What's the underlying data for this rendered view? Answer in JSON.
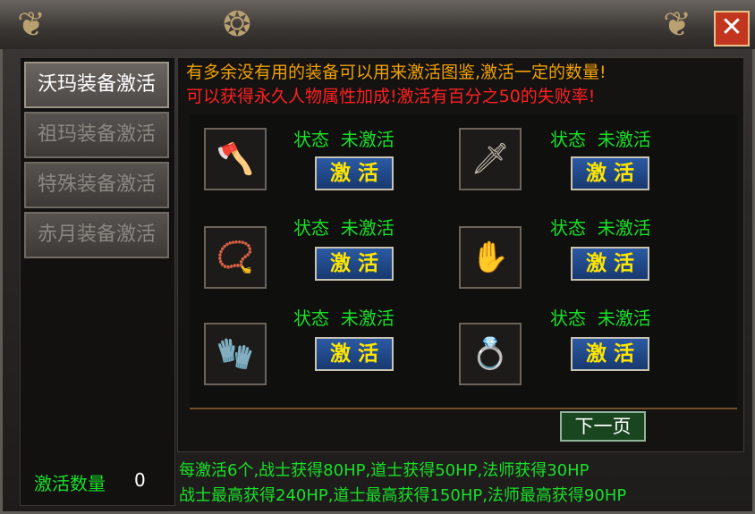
{
  "window": {
    "close_label": "✕"
  },
  "sidebar": {
    "tabs": [
      {
        "label": "沃玛装备激活",
        "active": true
      },
      {
        "label": "祖玛装备激活",
        "active": false
      },
      {
        "label": "特殊装备激活",
        "active": false
      },
      {
        "label": "赤月装备激活",
        "active": false
      }
    ],
    "count_label": "激活数量",
    "count_value": "0"
  },
  "notice": {
    "line1": "有多余没有用的装备可以用来激活图鉴,激活一定的数量!",
    "line2": "可以获得永久人物属性加成!激活有百分之50的失败率!"
  },
  "items": [
    {
      "icon": "axe-icon",
      "glyph": "🪓",
      "status_label": "状态",
      "status_value": "未激活",
      "button": "激 活"
    },
    {
      "icon": "sword-icon",
      "glyph": "🗡",
      "status_label": "状态",
      "status_value": "未激活",
      "button": "激 活"
    },
    {
      "icon": "necklace-icon",
      "glyph": "📿",
      "status_label": "状态",
      "status_value": "未激活",
      "button": "激 活"
    },
    {
      "icon": "bracelet-icon",
      "glyph": "✋",
      "status_label": "状态",
      "status_value": "未激活",
      "button": "激 活"
    },
    {
      "icon": "glove-icon",
      "glyph": "🧤",
      "status_label": "状态",
      "status_value": "未激活",
      "button": "激 活"
    },
    {
      "icon": "ring-icon",
      "glyph": "💍",
      "status_label": "状态",
      "status_value": "未激活",
      "button": "激 活"
    }
  ],
  "next_page": "下一页",
  "info": {
    "line1": "每激活6个,战士获得80HP,道士获得50HP,法师获得30HP",
    "line2": "战士最高获得240HP,道士最高获得150HP,法师最高获得90HP"
  },
  "colors": {
    "status_green": "#18e028",
    "button_yellow": "#ffe600",
    "notice_orange": "#f0a000",
    "notice_red": "#ff2020"
  }
}
